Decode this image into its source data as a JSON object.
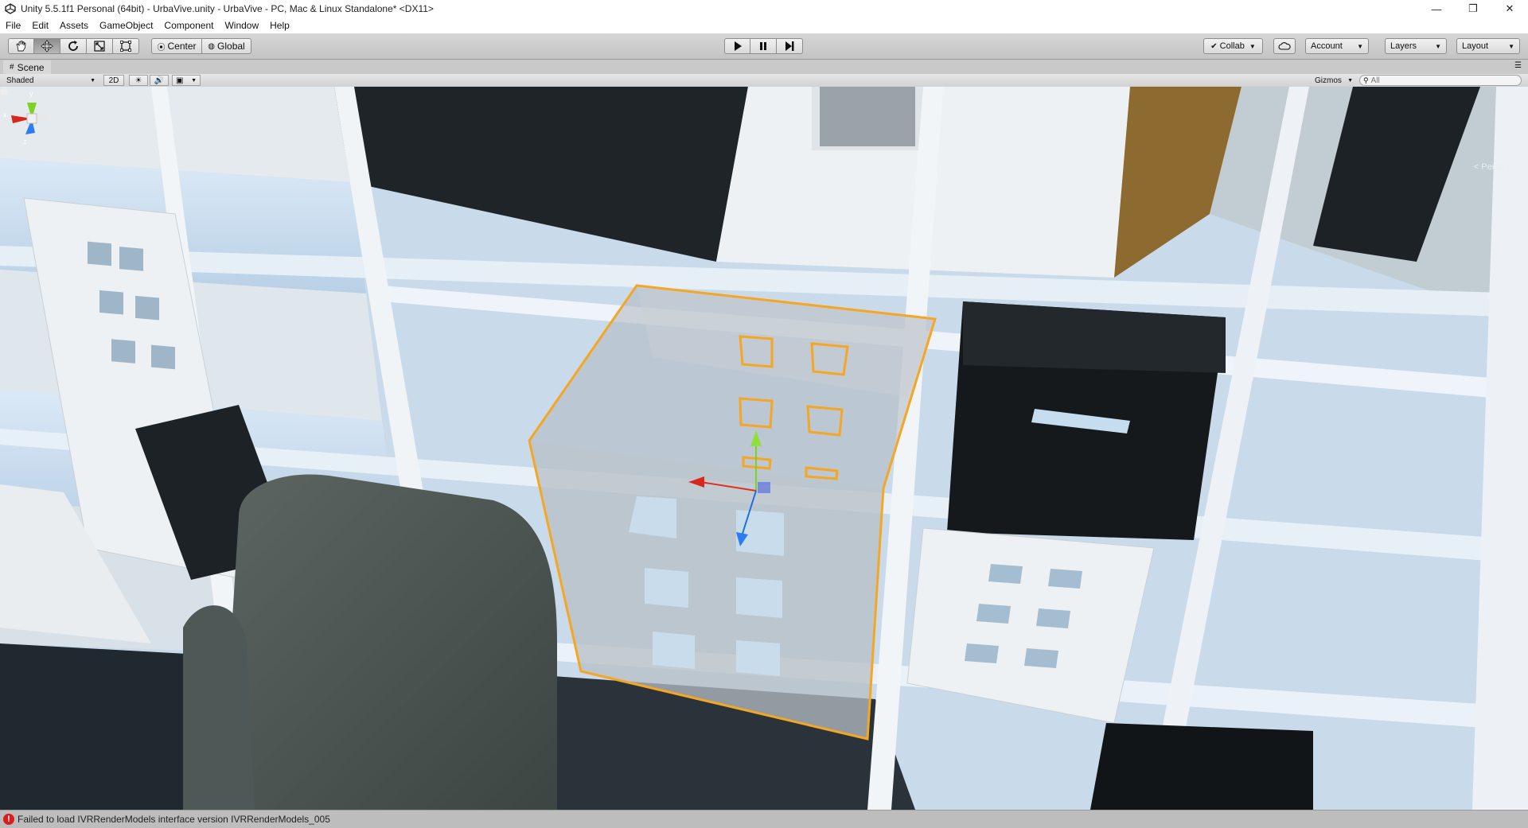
{
  "window": {
    "title": "Unity 5.5.1f1 Personal (64bit) - UrbaVive.unity - UrbaVive - PC, Mac & Linux Standalone* <DX11>",
    "minimize": "—",
    "maximize": "❐",
    "close": "✕"
  },
  "menu": [
    "File",
    "Edit",
    "Assets",
    "GameObject",
    "Component",
    "Window",
    "Help"
  ],
  "toolbar": {
    "tools": [
      "hand-icon",
      "move-icon",
      "rotate-icon",
      "scale-icon",
      "rect-tool-icon"
    ],
    "active_tool": 1,
    "pivot_label": "Center",
    "space_label": "Global",
    "play_icons": [
      "play-icon",
      "pause-icon",
      "step-icon"
    ],
    "collab_label": "Collab",
    "account_label": "Account",
    "layers_label": "Layers",
    "layout_label": "Layout"
  },
  "scene": {
    "tab_label": "Scene",
    "shading_mode": "Shaded",
    "mode_2d": "2D",
    "gizmos_label": "Gizmos",
    "search_placeholder": "All",
    "projection_label": "Persp",
    "gizmo_axes": {
      "y": "y",
      "x": "x",
      "z": "z"
    }
  },
  "status": {
    "message": "Failed to load IVRRenderModels interface version IVRRenderModels_005"
  },
  "colors": {
    "selection_outline": "#f5a623",
    "error": "#d81e1e"
  }
}
